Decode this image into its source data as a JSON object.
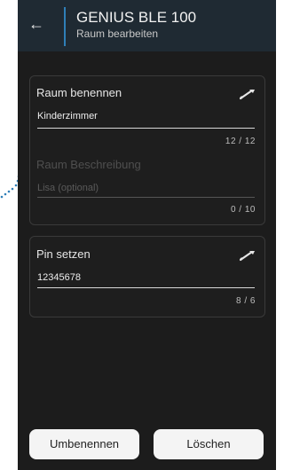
{
  "header": {
    "title": "GENIUS BLE 100",
    "subtitle": "Raum bearbeiten"
  },
  "room": {
    "label": "Raum benennen",
    "name_value": "Kinderzimmer",
    "name_counter": "12 / 12",
    "description_label": "Raum Beschreibung",
    "description_placeholder": "Lisa (optional)",
    "description_counter": "0 / 10"
  },
  "pin": {
    "label": "Pin setzen",
    "value": "12345678",
    "counter": "8 / 6"
  },
  "buttons": {
    "rename": "Umbenennen",
    "delete": "Löschen"
  },
  "colors": {
    "background": "#1c1c1c",
    "header": "#1f2a33",
    "accent": "#2f7fb8"
  }
}
